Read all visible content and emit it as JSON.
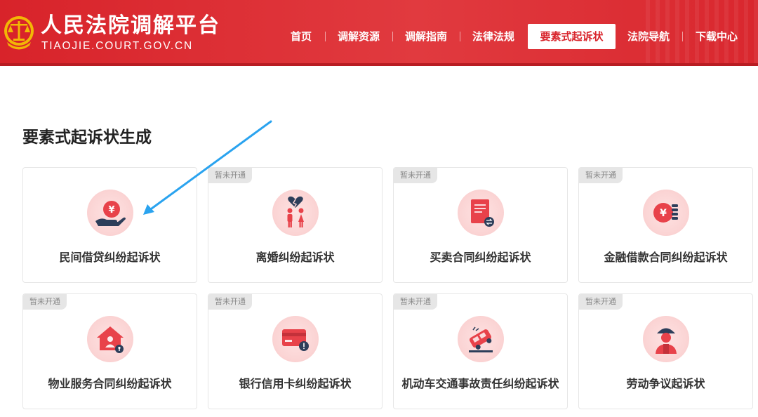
{
  "header": {
    "title": "人民法院调解平台",
    "subtitle": "TIAOJIE.COURT.GOV.CN",
    "nav": [
      {
        "label": "首页"
      },
      {
        "label": "调解资源"
      },
      {
        "label": "调解指南"
      },
      {
        "label": "法律法规"
      },
      {
        "label": "要素式起诉状",
        "active": true
      },
      {
        "label": "法院导航"
      },
      {
        "label": "下载中心"
      }
    ]
  },
  "main": {
    "section_title": "要素式起诉状生成",
    "cards": [
      {
        "label": "民间借贷纠纷起诉状",
        "icon": "money-hand-icon",
        "badge": ""
      },
      {
        "label": "离婚纠纷起诉状",
        "icon": "broken-heart-couple-icon",
        "badge": "暂未开通"
      },
      {
        "label": "买卖合同纠纷起诉状",
        "icon": "contract-exchange-icon",
        "badge": "暂未开通"
      },
      {
        "label": "金融借款合同纠纷起诉状",
        "icon": "coin-stack-icon",
        "badge": "暂未开通"
      },
      {
        "label": "物业服务合同纠纷起诉状",
        "icon": "house-person-icon",
        "badge": "暂未开通"
      },
      {
        "label": "银行信用卡纠纷起诉状",
        "icon": "credit-card-alert-icon",
        "badge": "暂未开通"
      },
      {
        "label": "机动车交通事故责任纠纷起诉状",
        "icon": "car-accident-icon",
        "badge": "暂未开通"
      },
      {
        "label": "劳动争议起诉状",
        "icon": "worker-icon",
        "badge": "暂未开通"
      }
    ]
  },
  "colors": {
    "brand_red": "#d8232a",
    "icon_red": "#e8424a",
    "icon_bg": "#fbd5d5",
    "badge_bg": "#e6e6e6",
    "annotation_arrow": "#2aa3ef"
  }
}
